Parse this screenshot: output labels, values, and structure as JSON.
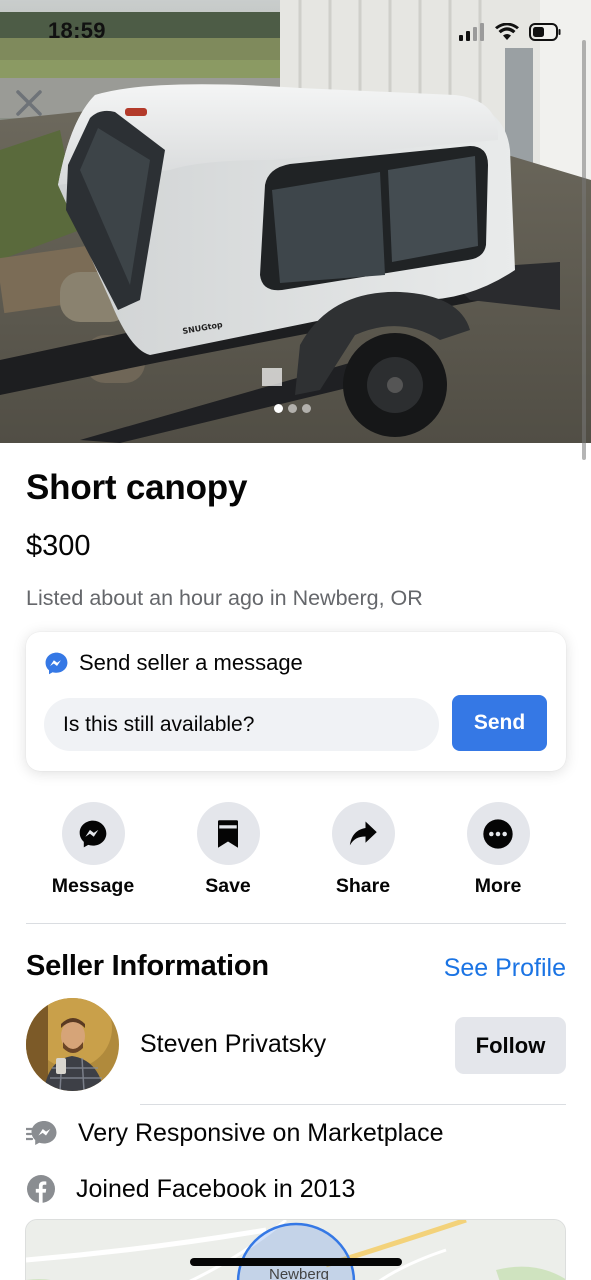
{
  "status_bar": {
    "time": "18:59"
  },
  "hero": {
    "photo_icon": "pickup-canopy-photo",
    "canopy_brand_text": "SNUGtop",
    "page_dots": 3,
    "active_dot": 1
  },
  "listing": {
    "title": "Short canopy",
    "price": "$300",
    "listed": "Listed about an hour ago in Newberg, OR"
  },
  "message_card": {
    "heading": "Send seller a message",
    "input_value": "Is this still available?",
    "send_label": "Send"
  },
  "actions": [
    {
      "label": "Message",
      "icon": "messenger-icon"
    },
    {
      "label": "Save",
      "icon": "bookmark-icon"
    },
    {
      "label": "Share",
      "icon": "share-arrow-icon"
    },
    {
      "label": "More",
      "icon": "more-dots-icon"
    }
  ],
  "seller": {
    "heading": "Seller Information",
    "see_profile": "See Profile",
    "name": "Steven Privatsky",
    "follow_label": "Follow",
    "facts": [
      {
        "text": "Very Responsive on Marketplace",
        "icon": "responsive-bolt-icon"
      },
      {
        "text": "Joined Facebook in 2013",
        "icon": "facebook-icon"
      }
    ]
  },
  "map": {
    "place_label": "Newberg"
  },
  "colors": {
    "accent_blue": "#3578e5",
    "link_blue": "#1b74e4",
    "secondary_text": "#65676b",
    "button_gray": "#e4e6eb"
  }
}
